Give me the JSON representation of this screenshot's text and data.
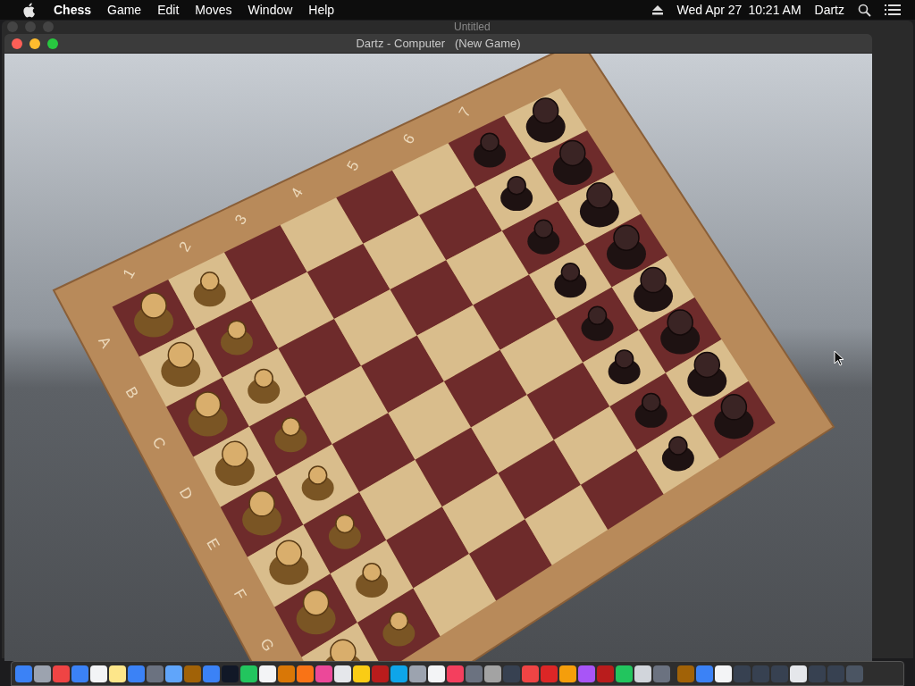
{
  "menu_bar": {
    "app": "Chess",
    "menus": [
      "Game",
      "Edit",
      "Moves",
      "Window",
      "Help"
    ],
    "date": "Wed Apr 27",
    "time": "10:21 AM",
    "user": "Dartz"
  },
  "background_window": {
    "title": "Untitled"
  },
  "window": {
    "title": "Dartz - Computer   (New Game)"
  },
  "board": {
    "ranks": [
      "1",
      "2",
      "3",
      "4",
      "5",
      "6",
      "7"
    ],
    "files": [
      "A",
      "B",
      "C",
      "D",
      "E",
      "F",
      "G"
    ]
  }
}
